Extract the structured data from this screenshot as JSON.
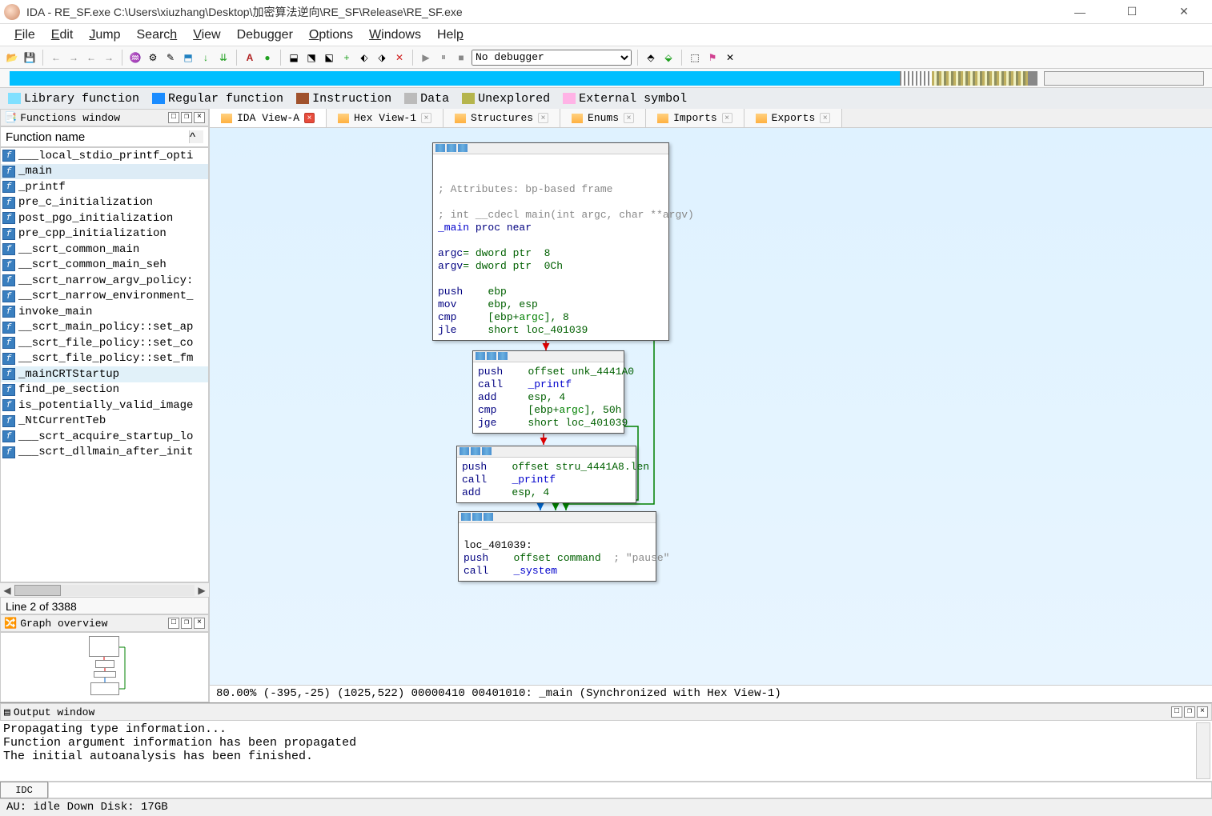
{
  "window": {
    "title": "IDA - RE_SF.exe C:\\Users\\xiuzhang\\Desktop\\加密算法逆向\\RE_SF\\Release\\RE_SF.exe"
  },
  "menu": [
    "File",
    "Edit",
    "Jump",
    "Search",
    "View",
    "Debugger",
    "Options",
    "Windows",
    "Help"
  ],
  "debugger_combo": "No debugger",
  "legend": [
    {
      "color": "#80e0ff",
      "label": "Library function"
    },
    {
      "color": "#1a8cff",
      "label": "Regular function"
    },
    {
      "color": "#a0522d",
      "label": "Instruction"
    },
    {
      "color": "#bbbbbb",
      "label": "Data"
    },
    {
      "color": "#b5b54d",
      "label": "Unexplored"
    },
    {
      "color": "#ffb3e6",
      "label": "External symbol"
    }
  ],
  "functions_panel": {
    "title": "Functions window",
    "column": "Function name",
    "line_status": "Line 2 of 3388",
    "items": [
      {
        "name": "___local_stdio_printf_opti"
      },
      {
        "name": "_main",
        "selected": true
      },
      {
        "name": "_printf"
      },
      {
        "name": "pre_c_initialization"
      },
      {
        "name": "post_pgo_initialization"
      },
      {
        "name": "pre_cpp_initialization"
      },
      {
        "name": "__scrt_common_main"
      },
      {
        "name": "__scrt_common_main_seh"
      },
      {
        "name": "__scrt_narrow_argv_policy:"
      },
      {
        "name": "__scrt_narrow_environment_"
      },
      {
        "name": "invoke_main"
      },
      {
        "name": "__scrt_main_policy::set_ap"
      },
      {
        "name": "__scrt_file_policy::set_co"
      },
      {
        "name": "__scrt_file_policy::set_fm"
      },
      {
        "name": "_mainCRTStartup",
        "hl": true
      },
      {
        "name": "find_pe_section"
      },
      {
        "name": "is_potentially_valid_image"
      },
      {
        "name": "_NtCurrentTeb"
      },
      {
        "name": "___scrt_acquire_startup_lo"
      },
      {
        "name": "___scrt_dllmain_after_init"
      }
    ]
  },
  "graph_overview": {
    "title": "Graph overview"
  },
  "tabs": [
    {
      "label": "IDA View-A",
      "active": true,
      "close_red": true
    },
    {
      "label": "Hex View-1"
    },
    {
      "label": "Structures"
    },
    {
      "label": "Enums"
    },
    {
      "label": "Imports"
    },
    {
      "label": "Exports"
    }
  ],
  "graph_status": "80.00% (-395,-25) (1025,522) 00000410 00401010: _main (Synchronized with Hex View-1)",
  "nodes": {
    "n1": {
      "attr_comment": "; Attributes: bp-based frame",
      "sig_comment": "; int __cdecl main(int argc, char **argv)",
      "proc": "_main proc near",
      "argc": "argc= dword ptr  8",
      "argv": "argv= dword ptr  0Ch",
      "l1a": "push",
      "l1b": "ebp",
      "l2a": "mov",
      "l2b": "ebp, esp",
      "l3a": "cmp",
      "l3b": "[ebp+",
      "l3c": "argc",
      "l3d": "], 8",
      "l4a": "jle",
      "l4b": "short loc_401039"
    },
    "n2": {
      "l1a": "push",
      "l1b": "offset unk_4441A0",
      "l2a": "call",
      "l2b": "_printf",
      "l3a": "add",
      "l3b": "esp, 4",
      "l4a": "cmp",
      "l4b": "[ebp+",
      "l4c": "argc",
      "l4d": "], 50h",
      "l5a": "jge",
      "l5b": "short loc_401039"
    },
    "n3": {
      "l1a": "push",
      "l1b": "offset stru_4441A8.len",
      "l2a": "call",
      "l2b": "_printf",
      "l3a": "add",
      "l3b": "esp, 4"
    },
    "n4": {
      "l0": "loc_401039:",
      "l1a": "push",
      "l1b": "offset command",
      "l1c": "; \"pause\"",
      "l2a": "call",
      "l2b": "_system"
    }
  },
  "output": {
    "title": "Output window",
    "lines": [
      "Propagating type information...",
      "Function argument information has been propagated",
      "The initial autoanalysis has been finished."
    ],
    "idc_label": "IDC"
  },
  "statusbar": "AU:  idle   Down    Disk: 17GB"
}
